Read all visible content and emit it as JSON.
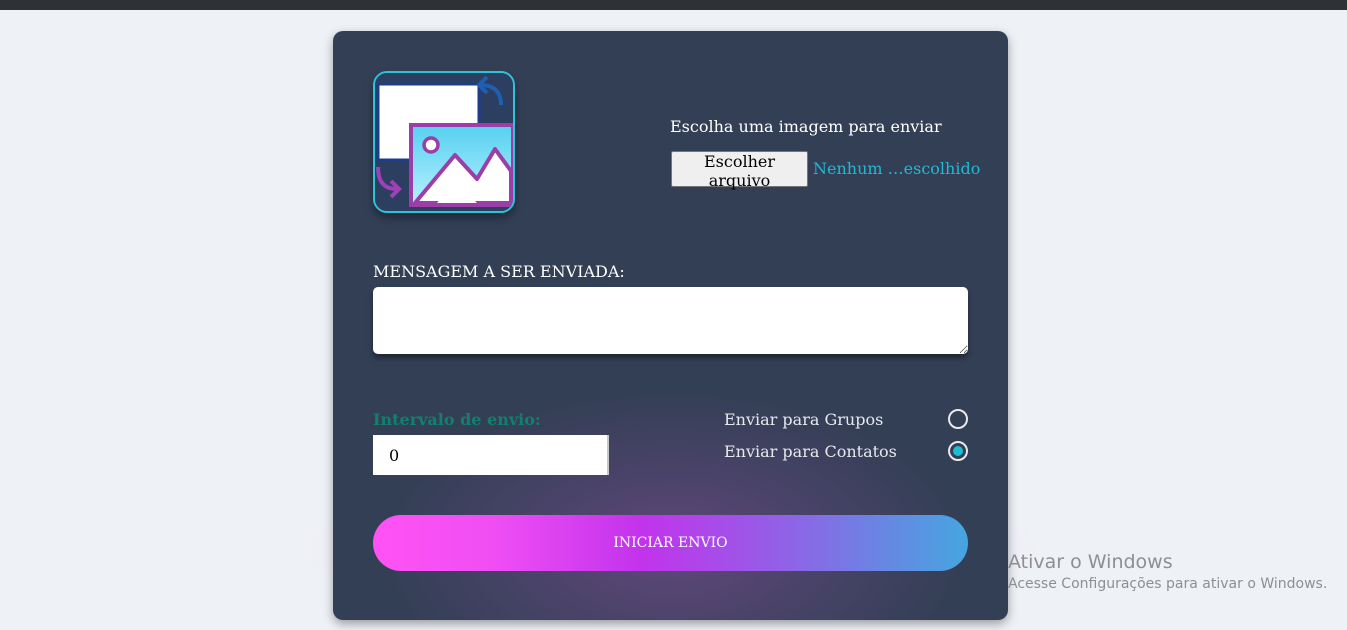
{
  "upload": {
    "label": "Escolha uma imagem para enviar",
    "button_label": "Escolher arquivo",
    "status": "Nenhum …escolhido"
  },
  "message": {
    "label": "MENSAGEM A SER ENVIADA:",
    "value": ""
  },
  "interval": {
    "label": "Intervalo de envio:",
    "value": "0"
  },
  "targets": [
    {
      "label": "Enviar para Grupos",
      "checked": false
    },
    {
      "label": "Enviar para Contatos",
      "checked": true
    }
  ],
  "start_button": "INICIAR ENVIO",
  "windows_watermark": {
    "title": "Ativar o Windows",
    "subtitle": "Acesse Configurações para ativar o Windows."
  },
  "colors": {
    "card": "#333f55",
    "accent_teal": "#1cbdd0",
    "interval_label": "#10816e",
    "button_gradient_start": "#ff52f4",
    "button_gradient_end": "#45a6e0"
  },
  "icons": {
    "logo": "image-swap-icon"
  }
}
